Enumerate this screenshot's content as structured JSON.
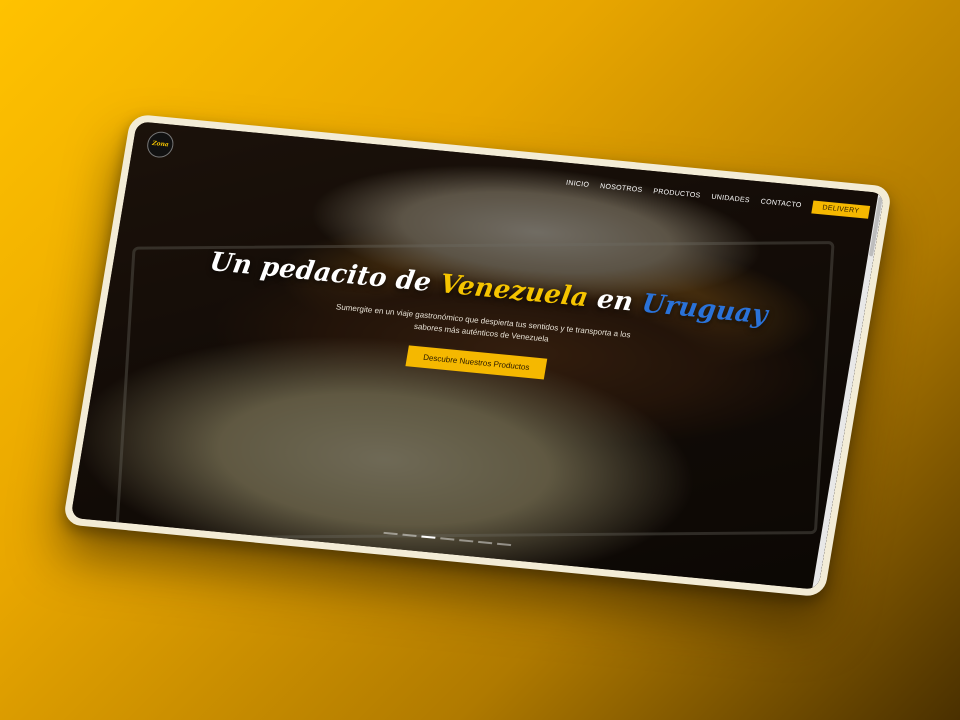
{
  "logo": {
    "text": "Zona"
  },
  "nav": {
    "items": [
      "INICIO",
      "NOSOTROS",
      "PRODUCTOS",
      "UNIDADES",
      "CONTACTO"
    ],
    "cta": "DELIVERY"
  },
  "hero": {
    "headline_part1": "Un pedacito de ",
    "headline_part2": "Venezuela",
    "headline_part3": " en ",
    "headline_part4": "Uruguay",
    "subtitle": "Sumergite en un viaje gastronómico que despierta tus sentidos y te transporta a los sabores más auténticos de Venezuela",
    "button": "Descubre Nuestros Productos"
  },
  "carousel": {
    "count": 7,
    "active_index": 2
  },
  "colors": {
    "accent": "#f5b800",
    "highlight_yellow": "#f5c400",
    "highlight_blue": "#2a72d8"
  }
}
